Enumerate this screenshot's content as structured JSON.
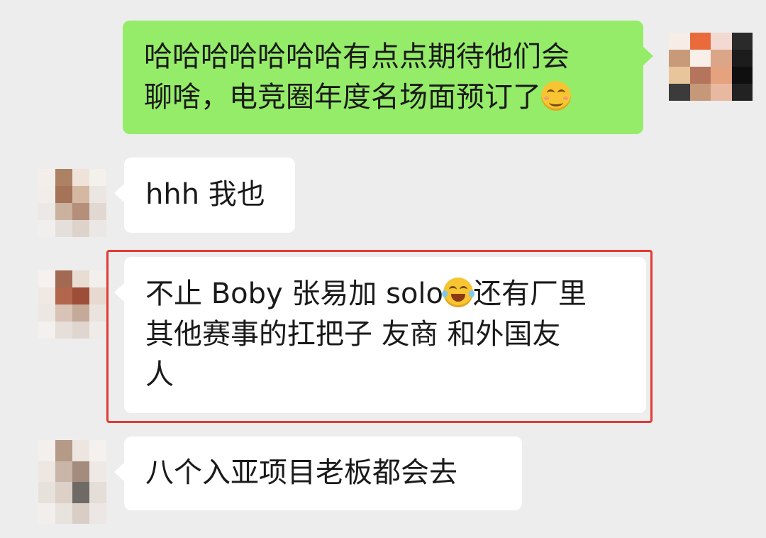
{
  "messages": [
    {
      "direction": "outgoing",
      "lines": [
        "哈哈哈哈哈哈哈有点点期待他们会",
        "聊啥，电竞圈年度名场面预订了"
      ],
      "trailing_emoji": "smiling-face-icon"
    },
    {
      "direction": "incoming",
      "lines": [
        "hhh 我也"
      ]
    },
    {
      "direction": "incoming",
      "highlighted": true,
      "highlight_color": "#e23a34",
      "line1_before_emoji": "不止 Boby 张易加 solo",
      "inline_emoji": "tears-of-joy-icon",
      "line1_after_emoji": "还有厂里",
      "lines_rest": [
        "其他赛事的扛把子 友商 和外国友",
        "人"
      ]
    },
    {
      "direction": "incoming",
      "lines": [
        "八个入亚项目老板都会去"
      ]
    }
  ],
  "colors": {
    "chat_background": "#ededed",
    "outgoing_bubble": "#95ec69",
    "incoming_bubble": "#ffffff",
    "highlight_border": "#e23a34"
  },
  "avatars": {
    "self": [
      "#f6ede6",
      "#e96a3b",
      "#f2d9d2",
      "#2a2a2a",
      "#c99a7a",
      "#f8efe8",
      "#dba588",
      "#1c1c1c",
      "#e8c59a",
      "#b5745c",
      "#e4a27e",
      "#0f0f0f",
      "#3b3b3b",
      "#c5987a",
      "#e8b9a0",
      "#222222"
    ],
    "contact_a": [
      "#f4eeea",
      "#ad8264",
      "#efe2d8",
      "#f4f0ec",
      "#f2ede9",
      "#a57357",
      "#d5b8a1",
      "#ece6e2",
      "#ebe8e5",
      "#cab29f",
      "#b58f79",
      "#e1d8d1",
      "#f1efed",
      "#e4dfda",
      "#ddd3cb",
      "#ebe7e4"
    ],
    "contact_b": [
      "#f6f1ee",
      "#a26a52",
      "#e9dcd3",
      "#f3efec",
      "#f0e8e2",
      "#b2664c",
      "#9e4e38",
      "#e8d9d0",
      "#ede7e3",
      "#d8c3b6",
      "#c6aa99",
      "#ebe3de",
      "#f3f0ee",
      "#e5ded9",
      "#e0d6cf",
      "#efebe8"
    ],
    "contact_c": [
      "#f3efec",
      "#b59a88",
      "#ece5e0",
      "#f4f1ef",
      "#ede6e1",
      "#c9b6a9",
      "#a38c7e",
      "#efe9e6",
      "#e7e1dc",
      "#dcd0c7",
      "#6f6a66",
      "#e4ddd8",
      "#f2eeeb",
      "#e9e3de",
      "#d9cec6",
      "#ece7e4"
    ]
  }
}
